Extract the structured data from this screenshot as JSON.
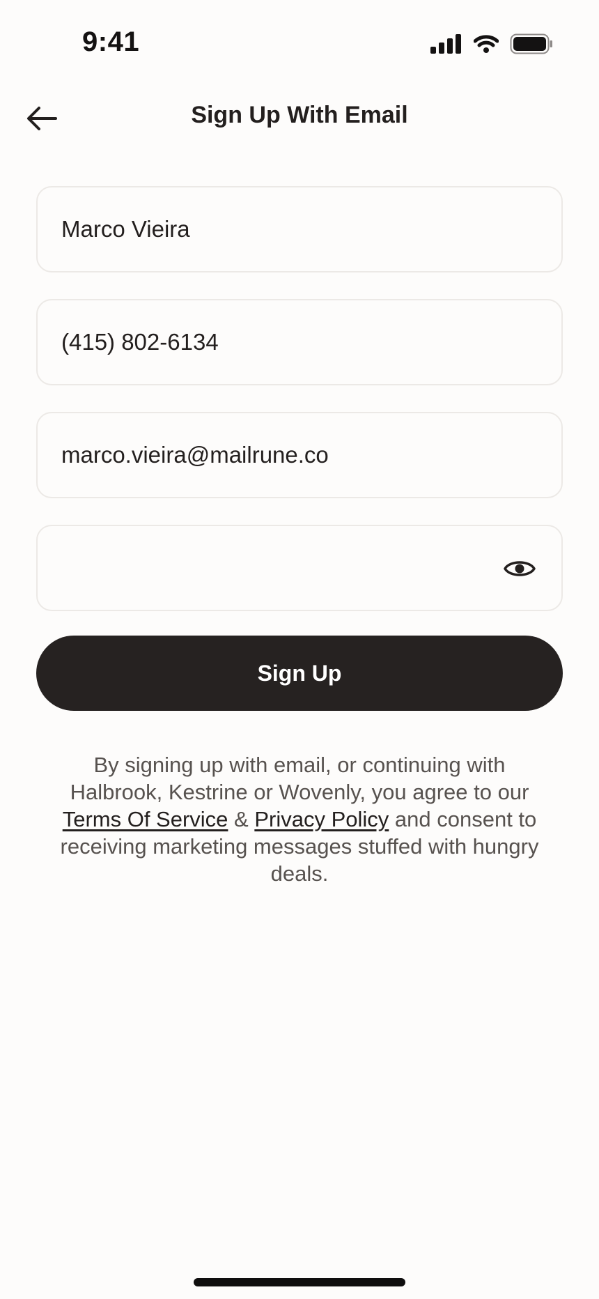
{
  "status_bar": {
    "time": "9:41"
  },
  "header": {
    "title": "Sign Up With Email",
    "back_icon": "arrow-left-icon"
  },
  "form": {
    "name": {
      "value": "Marco Vieira",
      "placeholder": ""
    },
    "phone": {
      "value": "(415) 802-6134",
      "placeholder": ""
    },
    "email": {
      "value": "marco.vieira@mailrune.co",
      "placeholder": ""
    },
    "password": {
      "value": "",
      "placeholder": "",
      "toggle_icon": "eye-icon"
    },
    "submit_label": "Sign Up"
  },
  "legal": {
    "text_before": "By signing up with email, or continuing with Halbrook, Kestrine or Wovenly, you agree to our ",
    "terms_link": "Terms Of Service",
    "joiner": " & ",
    "privacy_link": "Privacy Policy",
    "text_after": " and consent to receiving marketing messages stuffed with hungry deals."
  },
  "colors": {
    "background": "#fdfcfb",
    "button": "#262221",
    "field_border": "#ece9e6",
    "text": "#231f1e",
    "muted_text": "#57524f"
  }
}
